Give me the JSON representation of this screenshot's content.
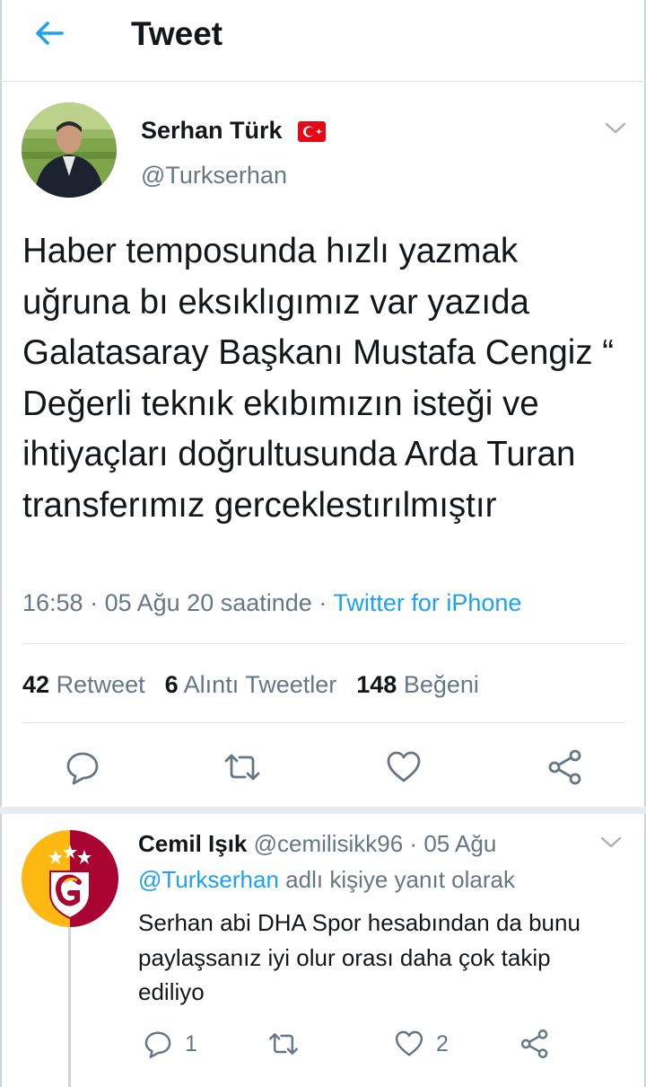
{
  "header": {
    "title": "Tweet",
    "back_icon": "arrow-left-icon"
  },
  "tweet": {
    "author_name": "Serhan Türk",
    "author_handle": "@Turkserhan",
    "text": "Haber temposunda hızlı yazmak uğruna bı eksıklıgımız var yazıda Galatasaray Başkanı Mustafa Cengiz “ Değerli teknık ekıbımızın isteği ve ihtiyaçları doğrultusunda Arda Turan transferımız gerceklestırılmıştır",
    "time": "16:58",
    "date": "05 Ağu 20 saatinde",
    "source": "Twitter for iPhone",
    "stats": {
      "retweets": "42",
      "retweets_label": "Retweet",
      "quotes": "6",
      "quotes_label": "Alıntı Tweetler",
      "likes": "148",
      "likes_label": "Beğeni"
    }
  },
  "reply": {
    "author_name": "Cemil Işık",
    "author_handle": "@cemilisikk96",
    "date": "05 Ağu",
    "reply_to_mention": "@Turkserhan",
    "reply_to_suffix": "adlı kişiye yanıt olarak",
    "text": "Serhan abi DHA Spor hesabından da bunu paylaşsanız iyi olur orası daha çok takip ediliyo",
    "reply_count": "1",
    "like_count": "2"
  },
  "colors": {
    "accent": "#1da1f2",
    "secondary_text": "#657786",
    "divider": "#dfe3e6",
    "galatasaray_red": "#a90432",
    "galatasaray_yellow": "#fdb912"
  }
}
